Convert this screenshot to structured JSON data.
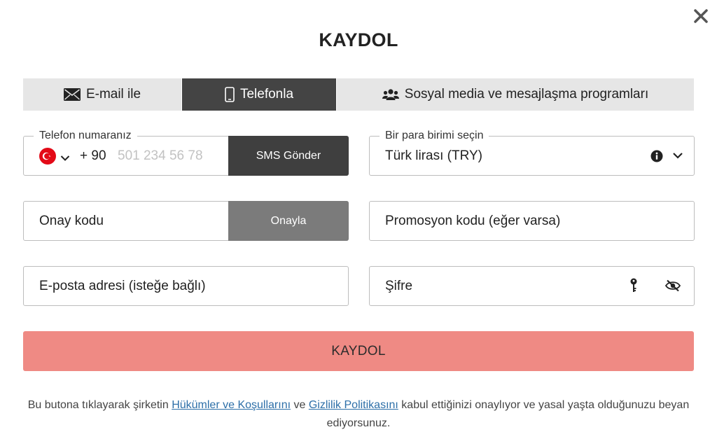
{
  "modal": {
    "title": "KAYDOL"
  },
  "tabs": [
    {
      "label": "E-mail ile",
      "icon": "envelope-icon",
      "active": false
    },
    {
      "label": "Telefonla",
      "icon": "phone-icon",
      "active": true
    },
    {
      "label": "Sosyal media ve mesajlaşma programları",
      "icon": "users-icon",
      "active": false
    }
  ],
  "phone": {
    "legend": "Telefon numaranız",
    "country_flag": "turkey-flag-icon",
    "dial_code": "+ 90",
    "placeholder": "501 234 56 78",
    "sms_button": "SMS Gönder"
  },
  "currency": {
    "legend": "Bir para birimi seçin",
    "value": "Türk lirası (TRY)"
  },
  "confirm": {
    "placeholder": "Onay kodu",
    "button": "Onayla"
  },
  "promo": {
    "placeholder": "Promosyon kodu (eğer varsa)"
  },
  "email": {
    "placeholder": "E-posta adresi (isteğe bağlı)"
  },
  "password": {
    "placeholder": "Şifre"
  },
  "submit": {
    "label": "KAYDOL"
  },
  "terms": {
    "prefix": "Bu butona tıklayarak şirketin ",
    "link1": "Hükümler ve Koşullarını",
    "middle": " ve ",
    "link2": "Gizlilik Politikasını",
    "suffix": " kabul ettiğinizi onaylıyor ve yasal yaşta olduğunuzu beyan ediyorsunuz."
  },
  "colors": {
    "accent_dark": "#3f3f3f",
    "submit_bg": "#ef8a84",
    "link": "#2d6fa8",
    "flag_red": "#e30a17"
  }
}
